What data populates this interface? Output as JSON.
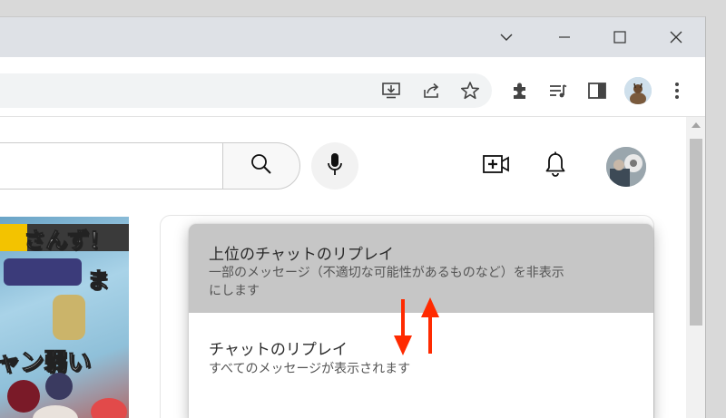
{
  "menu": {
    "items": [
      {
        "title": "上位のチャットのリプレイ",
        "desc_line1": "一部のメッセージ（不適切な可能性があるものなど）を非表示",
        "desc_line2": "にします",
        "selected": true
      },
      {
        "title": "チャットのリプレイ",
        "desc_line1": "すべてのメッセージが表示されます",
        "selected": false
      }
    ]
  },
  "video": {
    "texts": [
      "さんず！",
      "ま",
      "ャン弱い"
    ]
  },
  "colors": {
    "selected_bg": "#c6c6c6",
    "arrow": "#ff2a00",
    "titlebar": "#dee1e6"
  },
  "icons": {
    "titlebar": [
      "chevron-down-icon",
      "minimize-icon",
      "maximize-icon",
      "close-icon"
    ],
    "toolbar": [
      "install-icon",
      "share-icon",
      "bookmark-star-icon",
      "extensions-icon",
      "reading-list-icon",
      "side-panel-icon",
      "profile-avatar",
      "more-vert-icon"
    ],
    "header": [
      "search-icon",
      "mic-icon",
      "create-video-icon",
      "bell-icon",
      "account-avatar"
    ]
  }
}
